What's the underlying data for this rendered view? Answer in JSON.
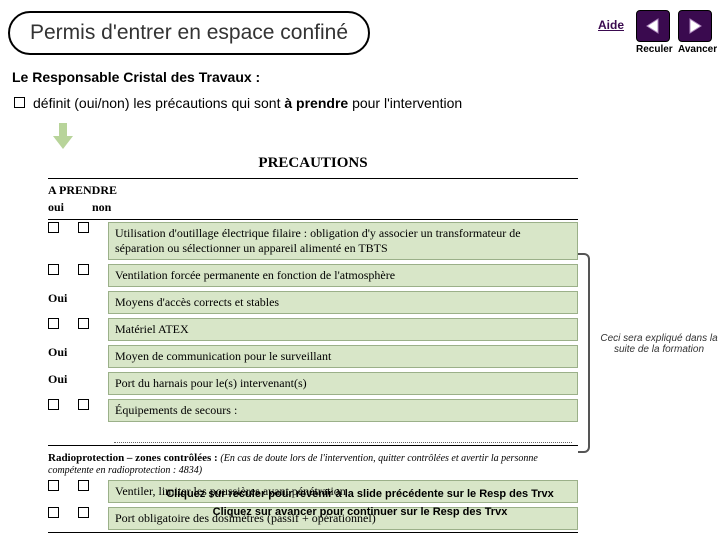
{
  "header": {
    "title": "Permis d'entrer en espace confiné",
    "aide": "Aide",
    "reculer": "Reculer",
    "avancer": "Avancer"
  },
  "subtitle": "Le Responsable Cristal des Travaux :",
  "bullet": {
    "pre": "définit (oui/non) les précautions qui sont ",
    "bold": "à prendre",
    "post": " pour l'intervention"
  },
  "form": {
    "title": "PRECAUTIONS",
    "sub": "A PRENDRE",
    "col_oui": "oui",
    "col_non": "non",
    "rows": [
      {
        "oui": "cb",
        "non": "cb",
        "text": "Utilisation d'outillage électrique filaire : obligation d'y associer un transformateur de séparation ou sélectionner un appareil alimenté en TBTS"
      },
      {
        "oui": "cb",
        "non": "cb",
        "text": "Ventilation forcée permanente en fonction de l'atmosphère"
      },
      {
        "oui": "Oui",
        "non": "",
        "text": "Moyens d'accès corrects et stables"
      },
      {
        "oui": "cb",
        "non": "cb",
        "text": "Matériel ATEX"
      },
      {
        "oui": "Oui",
        "non": "",
        "text": "Moyen de communication pour le surveillant"
      },
      {
        "oui": "Oui",
        "non": "",
        "text": "Port du harnais pour le(s) intervenant(s)"
      },
      {
        "oui": "cb",
        "non": "cb",
        "text": "Équipements de secours :"
      }
    ],
    "radio_header": "Radioprotection – zones contrôlées :",
    "radio_note": "(En cas de doute lors de l'intervention, quitter contrôlées et avertir la personne compétente en radioprotection : 4834)",
    "radio_rows": [
      {
        "text": "Ventiler, limiter les poussières avant pénétration"
      },
      {
        "text": "Port obligatoire des dosimètres (passif + opérationnel)"
      }
    ]
  },
  "side_note": "Ceci sera expliqué dans la suite de la formation",
  "footer": {
    "line1": "Cliquez sur reculer pour revenir à la slide précédente sur le Resp des Trvx",
    "line2": "Cliquez sur avancer pour continuer sur le Resp des Trvx"
  }
}
